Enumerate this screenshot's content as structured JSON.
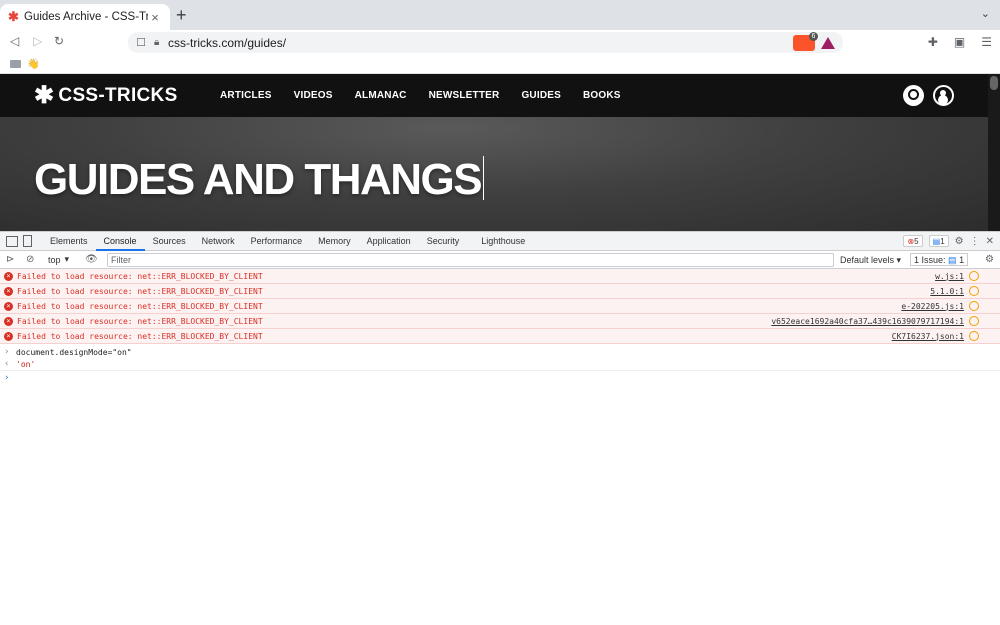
{
  "browser": {
    "tab_title": "Guides Archive - CSS-Tricks Ar",
    "tab_favicon": "✱",
    "url": "css-tricks.com/guides/",
    "brave_count": "6"
  },
  "site": {
    "logo": "CSS-TRICKS",
    "menu": [
      "ARTICLES",
      "VIDEOS",
      "ALMANAC",
      "NEWSLETTER",
      "GUIDES",
      "BOOKS"
    ],
    "hero_title": "GUIDES AND THANGS"
  },
  "devtools": {
    "tabs": [
      "Elements",
      "Console",
      "Sources",
      "Network",
      "Performance",
      "Memory",
      "Application",
      "Security",
      "Lighthouse"
    ],
    "active_tab": "Console",
    "error_count": "5",
    "info_count": "1",
    "context": "top",
    "filter_placeholder": "Filter",
    "levels": "Default levels",
    "issues": "1 Issue:",
    "issues_count": "1",
    "errors": [
      {
        "msg": "Failed to load resource: net::ERR_BLOCKED_BY_CLIENT",
        "src": "w.js:1"
      },
      {
        "msg": "Failed to load resource: net::ERR_BLOCKED_BY_CLIENT",
        "src": "5.1.0:1"
      },
      {
        "msg": "Failed to load resource: net::ERR_BLOCKED_BY_CLIENT",
        "src": "e-202205.js:1"
      },
      {
        "msg": "Failed to load resource: net::ERR_BLOCKED_BY_CLIENT",
        "src": "v652eace1692a40cfa37…439c1639079717194:1"
      },
      {
        "msg": "Failed to load resource: net::ERR_BLOCKED_BY_CLIENT",
        "src": "CK7I6237.json:1"
      }
    ],
    "command": "document.designMode=\"on\"",
    "result": "'on'"
  },
  "colors": {
    "error": "#d93025",
    "accent": "#1a73e8"
  }
}
